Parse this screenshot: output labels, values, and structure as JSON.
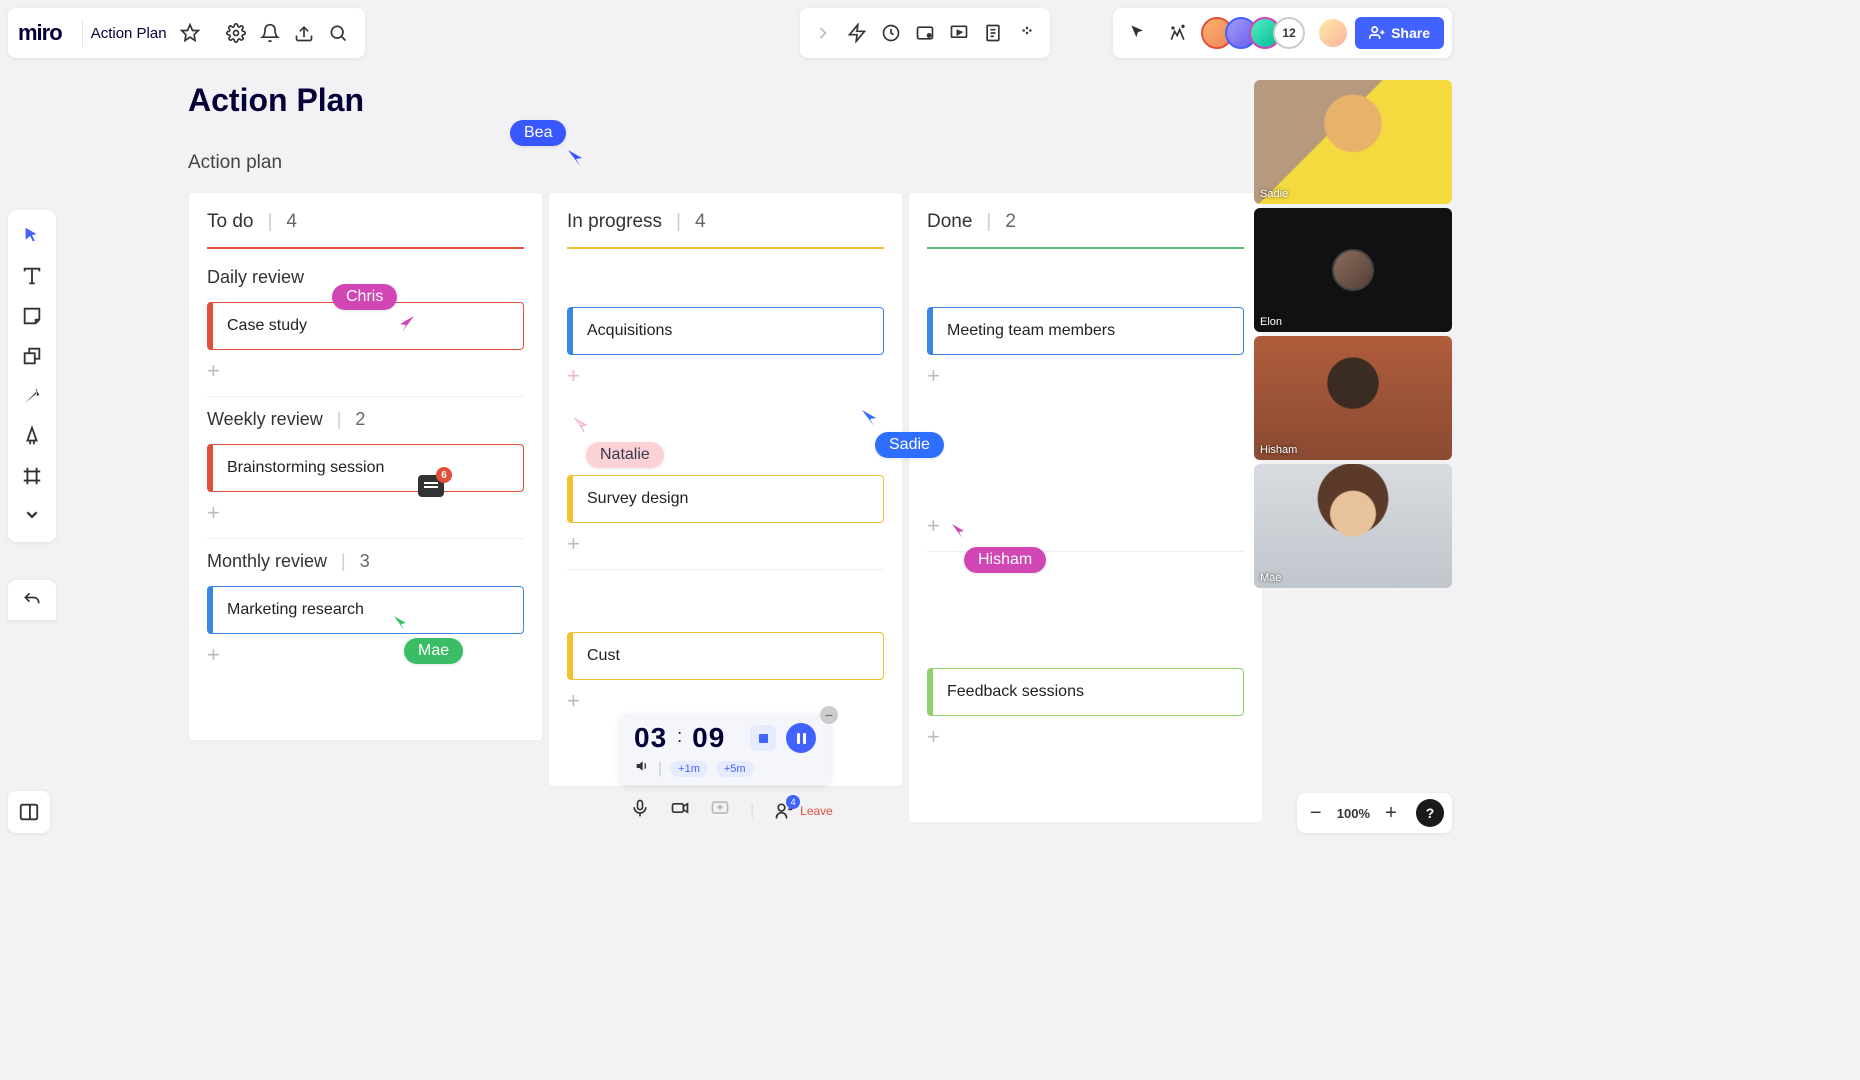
{
  "app": {
    "logo": "miro",
    "board_name": "Action Plan"
  },
  "share": {
    "label": "Share",
    "participant_count": "12"
  },
  "board": {
    "title": "Action Plan",
    "subtitle": "Action plan"
  },
  "columns": {
    "todo": {
      "title": "To do",
      "count": "4"
    },
    "prog": {
      "title": "In progress",
      "count": "4"
    },
    "done": {
      "title": "Done",
      "count": "2"
    }
  },
  "sections": {
    "daily": {
      "title": "Daily review",
      "count": ""
    },
    "weekly": {
      "title": "Weekly review",
      "count": "2",
      "comments": "6"
    },
    "monthly": {
      "title": "Monthly review",
      "count": "3"
    }
  },
  "cards": {
    "case_study": "Case study",
    "acquisitions": "Acquisitions",
    "meeting": "Meeting team members",
    "brainstorm": "Brainstorming session",
    "survey": "Survey design",
    "marketing": "Marketing research",
    "cust": "Cust",
    "feedback": "Feedback sessions"
  },
  "cursors": {
    "bea": "Bea",
    "chris": "Chris",
    "natalie": "Natalie",
    "sadie": "Sadie",
    "mae": "Mae",
    "hisham": "Hisham"
  },
  "timer": {
    "mm": "03",
    "ss": "09",
    "add1": "+1m",
    "add5": "+5m"
  },
  "controls": {
    "leave": "Leave",
    "people_badge": "4"
  },
  "video": {
    "p1": "Sadie",
    "p2": "Elon",
    "p3": "Hisham",
    "p4": "Mae"
  },
  "zoom": {
    "pct": "100%"
  }
}
